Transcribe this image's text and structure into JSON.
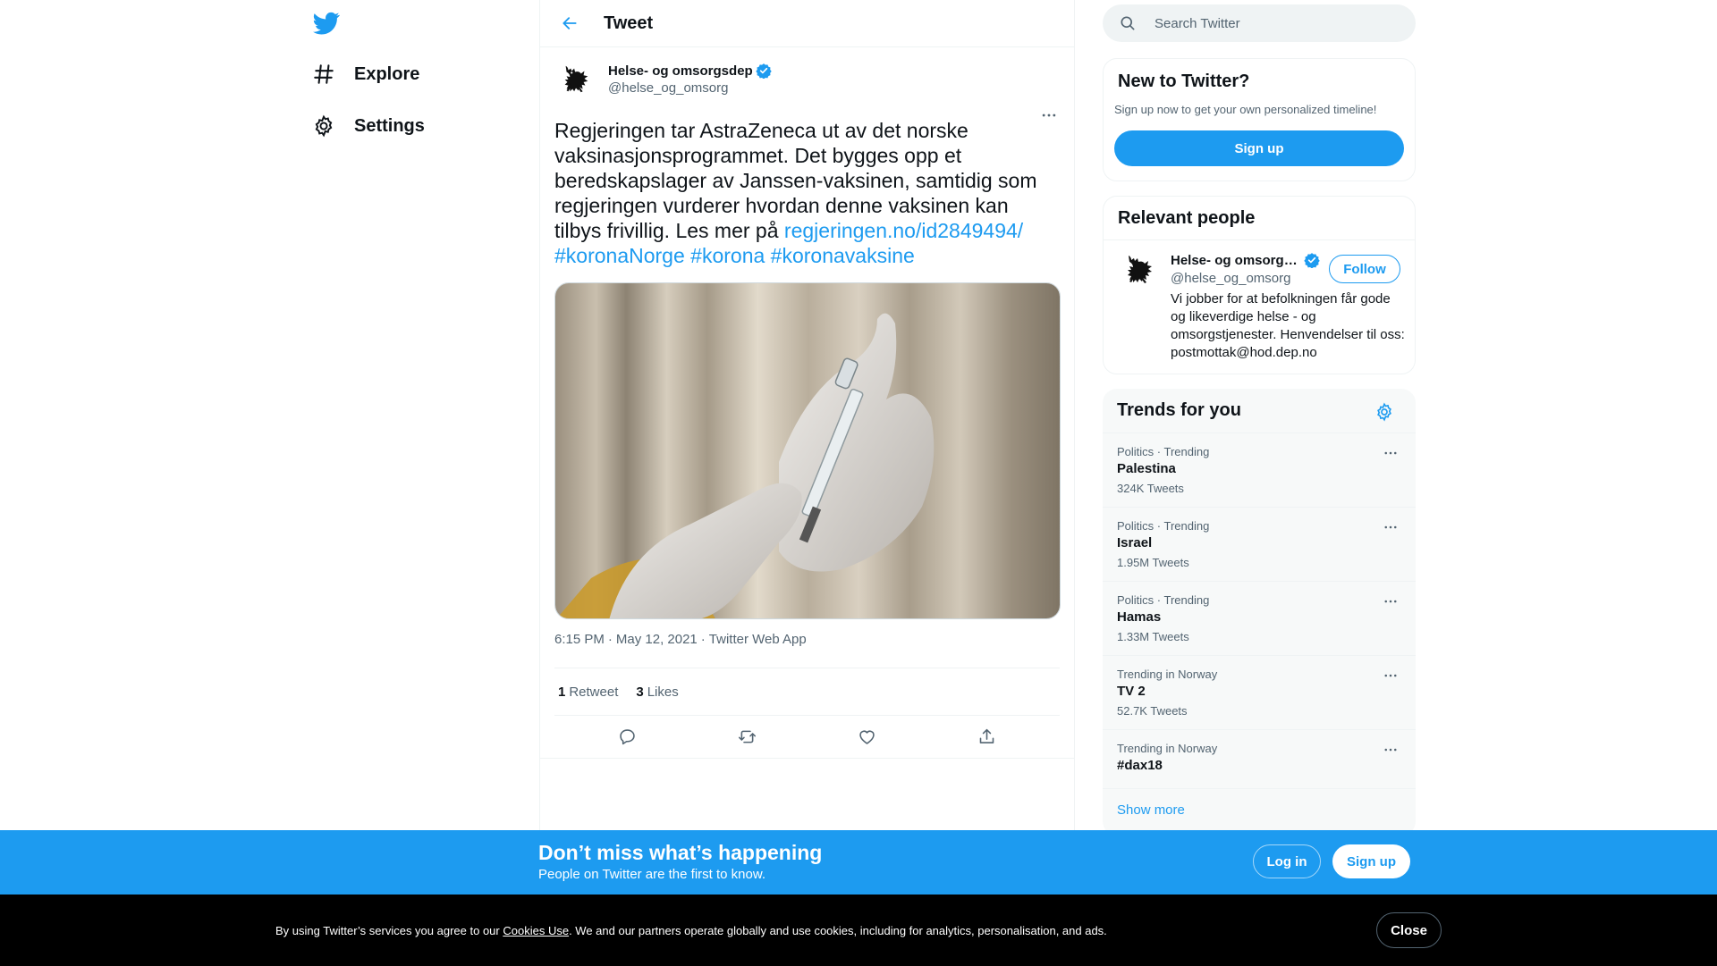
{
  "colors": {
    "accent": "#1d9bf0",
    "text": "#0f1419",
    "secondary": "#536471",
    "border": "#eff3f4"
  },
  "nav": {
    "logo_icon": "twitter-bird-icon",
    "items": [
      {
        "label": "Explore",
        "icon": "hashtag-icon"
      },
      {
        "label": "Settings",
        "icon": "gear-icon"
      }
    ]
  },
  "header": {
    "title": "Tweet",
    "back_icon": "arrow-left-icon"
  },
  "tweet": {
    "author_name": "Helse- og omsorgsdep",
    "author_handle": "@helse_og_omsorg",
    "text_plain": "Regjeringen tar AstraZeneca ut av det norske vaksinasjonsprogrammet. Det bygges opp et beredskapslager av Janssen-vaksinen, samtidig som regjeringen vurderer hvordan denne vaksinen kan tilbys frivillig. Les mer på ",
    "link": "regjeringen.no/id2849494/",
    "hashtags": [
      "#koronaNorge",
      "#korona",
      "#koronavaksine"
    ],
    "time": "6:15 PM",
    "date": "May 12, 2021",
    "source": "Twitter Web App",
    "retweets": "1",
    "retweets_label": "Retweet",
    "likes": "3",
    "likes_label": "Likes"
  },
  "search": {
    "placeholder": "Search Twitter"
  },
  "new_to_twitter": {
    "title": "New to Twitter?",
    "subtitle": "Sign up now to get your own personalized timeline!",
    "button": "Sign up"
  },
  "relevant_people": {
    "title": "Relevant people",
    "name": "Helse- og omsorgsdep",
    "handle": "@helse_og_omsorg",
    "follow": "Follow",
    "bio": "Vi jobber for at befolkningen får gode og likeverdige helse - og omsorgstjenester. Henvendelser til oss: postmottak@hod.dep.no"
  },
  "trends": {
    "title": "Trends for you",
    "items": [
      {
        "context": "Politics · Trending",
        "name": "Palestina",
        "count": "324K Tweets"
      },
      {
        "context": "Politics · Trending",
        "name": "Israel",
        "count": "1.95M Tweets"
      },
      {
        "context": "Politics · Trending",
        "name": "Hamas",
        "count": "1.33M Tweets"
      },
      {
        "context": "Trending in Norway",
        "name": "TV 2",
        "count": "52.7K Tweets"
      },
      {
        "context": "Trending in Norway",
        "name": "#dax18",
        "count": ""
      }
    ],
    "show_more": "Show more"
  },
  "bottom_bar": {
    "title": "Don’t miss what’s happening",
    "subtitle": "People on Twitter are the first to know.",
    "login": "Log in",
    "signup": "Sign up"
  },
  "cookie": {
    "prefix": "By using Twitter’s services you agree to our ",
    "link": "Cookies Use",
    "suffix": ". We and our partners operate globally and use cookies, including for analytics, personalisation, and ads.",
    "close": "Close"
  }
}
